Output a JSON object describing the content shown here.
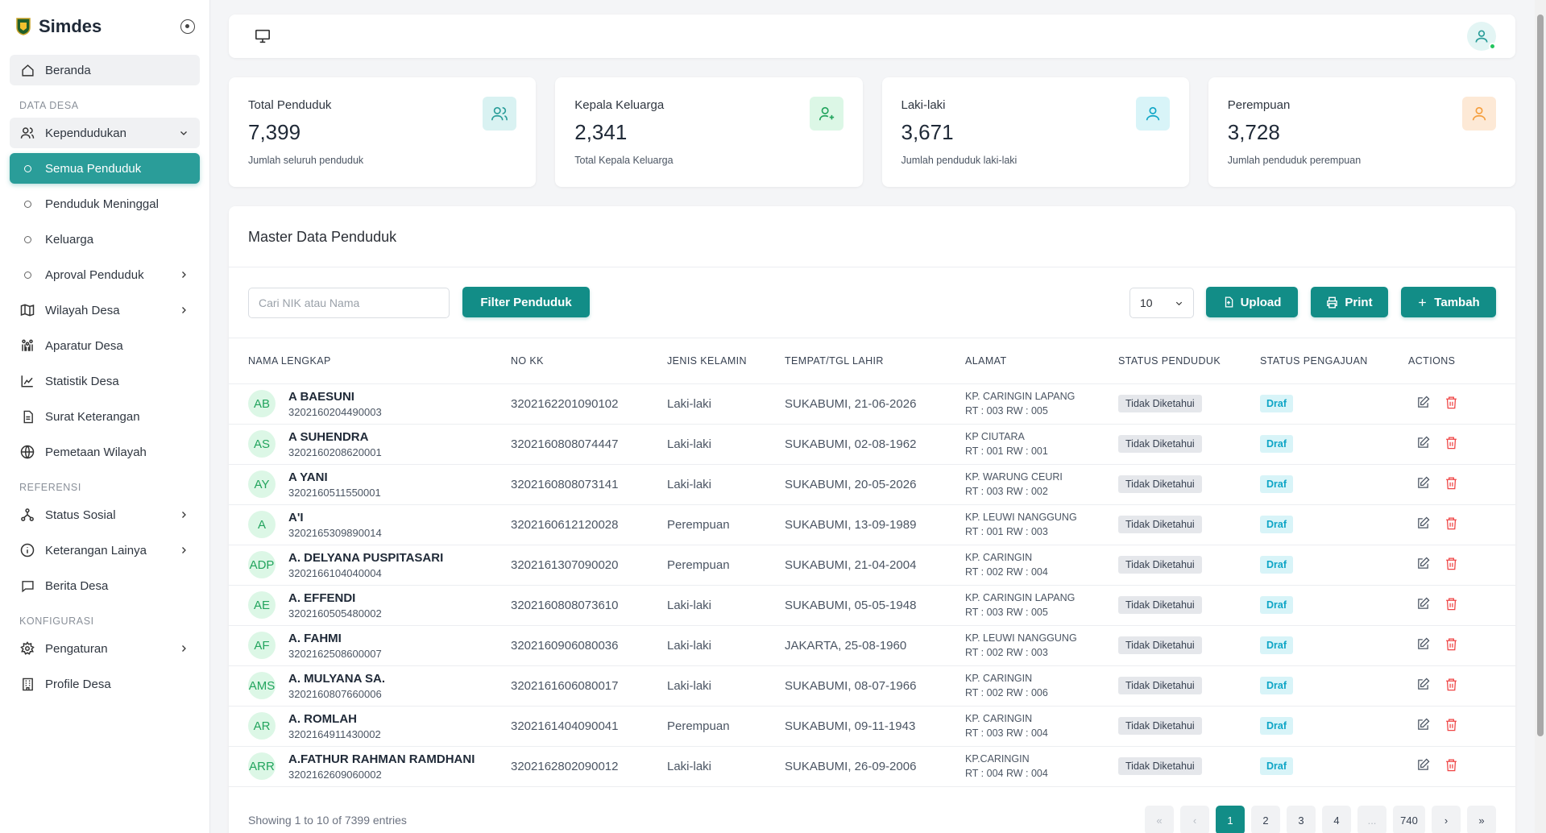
{
  "app": {
    "name": "Simdes"
  },
  "sidebar": {
    "home": "Beranda",
    "section_data": "DATA DESA",
    "kependudukan": "Kependudukan",
    "sub": {
      "semua": "Semua Penduduk",
      "meninggal": "Penduduk Meninggal",
      "keluarga": "Keluarga",
      "aproval": "Aproval Penduduk"
    },
    "wilayah": "Wilayah Desa",
    "aparatur": "Aparatur Desa",
    "statistik": "Statistik Desa",
    "surat": "Surat Keterangan",
    "pemetaan": "Pemetaan Wilayah",
    "section_ref": "REFERENSI",
    "status_sosial": "Status Sosial",
    "keterangan": "Keterangan Lainya",
    "berita": "Berita Desa",
    "section_conf": "KONFIGURASI",
    "pengaturan": "Pengaturan",
    "profile": "Profile Desa"
  },
  "stats": [
    {
      "title": "Total Penduduk",
      "value": "7,399",
      "sub": "Jumlah seluruh penduduk",
      "icon": "users-icon",
      "bg": "#d9f2f2",
      "fg": "#2a9d99"
    },
    {
      "title": "Kepala Keluarga",
      "value": "2,341",
      "sub": "Total Kepala Keluarga",
      "icon": "user-plus-icon",
      "bg": "#dcf7e6",
      "fg": "#22a45d"
    },
    {
      "title": "Laki-laki",
      "value": "3,671",
      "sub": "Jumlah penduduk laki-laki",
      "icon": "user-icon",
      "bg": "#d8f4f8",
      "fg": "#0ea5c6"
    },
    {
      "title": "Perempuan",
      "value": "3,728",
      "sub": "Jumlah penduduk perempuan",
      "icon": "user-icon",
      "bg": "#fde9d6",
      "fg": "#f59e3c"
    }
  ],
  "card": {
    "title": "Master Data Penduduk",
    "search_placeholder": "Cari NIK atau Nama",
    "filter_label": "Filter Penduduk",
    "page_size": "10",
    "upload_label": "Upload",
    "print_label": "Print",
    "add_label": "Tambah"
  },
  "table": {
    "headers": [
      "NAMA LENGKAP",
      "NO KK",
      "JENIS KELAMIN",
      "TEMPAT/TGL LAHIR",
      "ALAMAT",
      "STATUS PENDUDUK",
      "STATUS PENGAJUAN",
      "ACTIONS"
    ],
    "rows": [
      {
        "initials": "AB",
        "name": "A BAESUNI",
        "nik": "3202160204490003",
        "kk": "3202162201090102",
        "gender": "Laki-laki",
        "birth": "SUKABUMI, 21-06-2026",
        "addr1": "KP. CARINGIN LAPANG",
        "addr2": "RT : 003 RW : 005",
        "status": "Tidak Diketahui",
        "pengajuan": "Draf"
      },
      {
        "initials": "AS",
        "name": "A SUHENDRA",
        "nik": "3202160208620001",
        "kk": "3202160808074447",
        "gender": "Laki-laki",
        "birth": "SUKABUMI, 02-08-1962",
        "addr1": "KP CIUTARA",
        "addr2": "RT : 001 RW : 001",
        "status": "Tidak Diketahui",
        "pengajuan": "Draf"
      },
      {
        "initials": "AY",
        "name": "A YANI",
        "nik": "3202160511550001",
        "kk": "3202160808073141",
        "gender": "Laki-laki",
        "birth": "SUKABUMI, 20-05-2026",
        "addr1": "KP. WARUNG CEURI",
        "addr2": "RT : 003 RW : 002",
        "status": "Tidak Diketahui",
        "pengajuan": "Draf"
      },
      {
        "initials": "A",
        "name": "A'I",
        "nik": "3202165309890014",
        "kk": "3202160612120028",
        "gender": "Perempuan",
        "birth": "SUKABUMI, 13-09-1989",
        "addr1": "KP. LEUWI NANGGUNG",
        "addr2": "RT : 001 RW : 003",
        "status": "Tidak Diketahui",
        "pengajuan": "Draf"
      },
      {
        "initials": "ADP",
        "name": "A. DELYANA PUSPITASARI",
        "nik": "3202166104040004",
        "kk": "3202161307090020",
        "gender": "Perempuan",
        "birth": "SUKABUMI, 21-04-2004",
        "addr1": "KP. CARINGIN",
        "addr2": "RT : 002 RW : 004",
        "status": "Tidak Diketahui",
        "pengajuan": "Draf"
      },
      {
        "initials": "AE",
        "name": "A. EFFENDI",
        "nik": "3202160505480002",
        "kk": "3202160808073610",
        "gender": "Laki-laki",
        "birth": "SUKABUMI, 05-05-1948",
        "addr1": "KP. CARINGIN LAPANG",
        "addr2": "RT : 003 RW : 005",
        "status": "Tidak Diketahui",
        "pengajuan": "Draf"
      },
      {
        "initials": "AF",
        "name": "A. FAHMI",
        "nik": "3202162508600007",
        "kk": "3202160906080036",
        "gender": "Laki-laki",
        "birth": "JAKARTA, 25-08-1960",
        "addr1": "KP. LEUWI NANGGUNG",
        "addr2": "RT : 002 RW : 003",
        "status": "Tidak Diketahui",
        "pengajuan": "Draf"
      },
      {
        "initials": "AMS",
        "name": "A. MULYANA SA.",
        "nik": "3202160807660006",
        "kk": "3202161606080017",
        "gender": "Laki-laki",
        "birth": "SUKABUMI, 08-07-1966",
        "addr1": "KP. CARINGIN",
        "addr2": "RT : 002 RW : 006",
        "status": "Tidak Diketahui",
        "pengajuan": "Draf"
      },
      {
        "initials": "AR",
        "name": "A. ROMLAH",
        "nik": "3202164911430002",
        "kk": "3202161404090041",
        "gender": "Perempuan",
        "birth": "SUKABUMI, 09-11-1943",
        "addr1": "KP. CARINGIN",
        "addr2": "RT : 003 RW : 004",
        "status": "Tidak Diketahui",
        "pengajuan": "Draf"
      },
      {
        "initials": "ARR",
        "name": "A.FATHUR RAHMAN RAMDHANI",
        "nik": "3202162609060002",
        "kk": "3202162802090012",
        "gender": "Laki-laki",
        "birth": "SUKABUMI, 26-09-2006",
        "addr1": "KP.CARINGIN",
        "addr2": "RT : 004 RW : 004",
        "status": "Tidak Diketahui",
        "pengajuan": "Draf"
      }
    ]
  },
  "footer": {
    "info": "Showing 1 to 10 of 7399 entries",
    "pages": [
      "«",
      "‹",
      "1",
      "2",
      "3",
      "4",
      "...",
      "740",
      "›",
      "»"
    ],
    "current": "1"
  }
}
